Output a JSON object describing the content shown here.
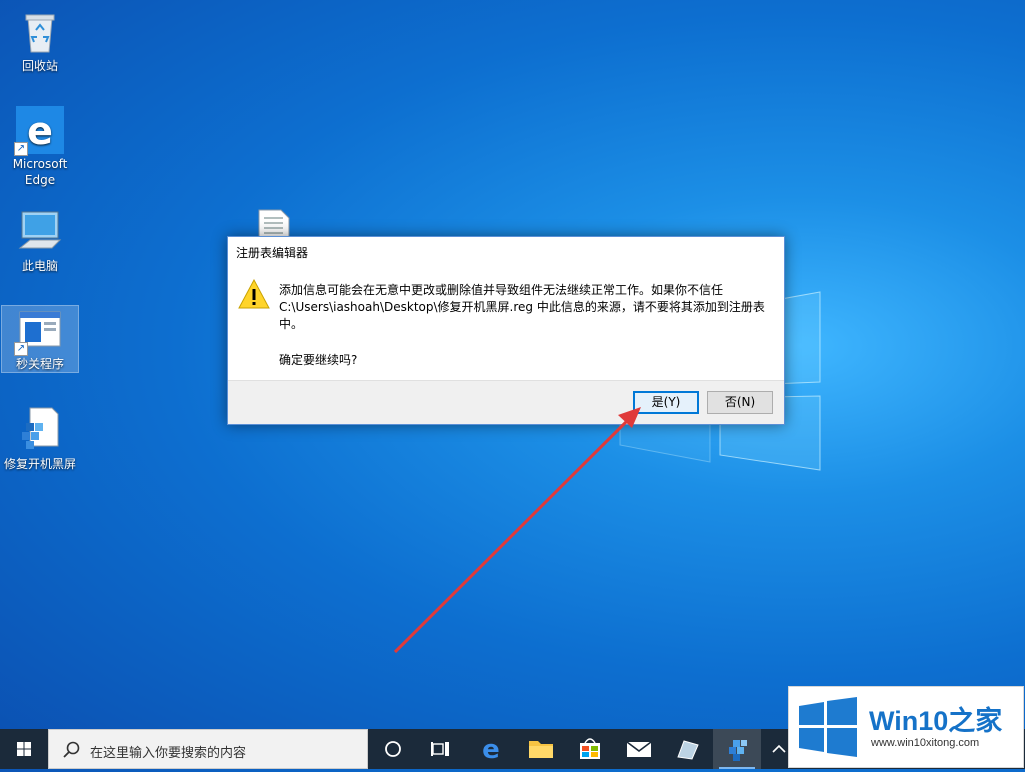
{
  "desktop": {
    "icons": [
      {
        "label": "回收站"
      },
      {
        "label": "Microsoft Edge"
      },
      {
        "label": "此电脑"
      },
      {
        "label": "秒关程序"
      },
      {
        "label": "修复开机黑屏"
      }
    ]
  },
  "dialog": {
    "title": "注册表编辑器",
    "message": "添加信息可能会在无意中更改或删除值并导致组件无法继续正常工作。如果你不信任 C:\\Users\\iashoah\\Desktop\\修复开机黑屏.reg 中此信息的来源，请不要将其添加到注册表中。",
    "question": "确定要继续吗?",
    "yes_label": "是(Y)",
    "no_label": "否(N)"
  },
  "taskbar": {
    "search_placeholder": "在这里输入你要搜索的内容",
    "icons": [
      "cortana-icon",
      "task-view-icon",
      "edge-icon",
      "file-explorer-icon",
      "store-icon",
      "mail-icon",
      "app-icon",
      "regedit-icon",
      "show-hidden-icons"
    ]
  },
  "watermark": {
    "title": "Win10之家",
    "url": "www.win10xitong.com"
  },
  "colors": {
    "accent": "#0078d7",
    "arrow": "#e03a3a"
  }
}
